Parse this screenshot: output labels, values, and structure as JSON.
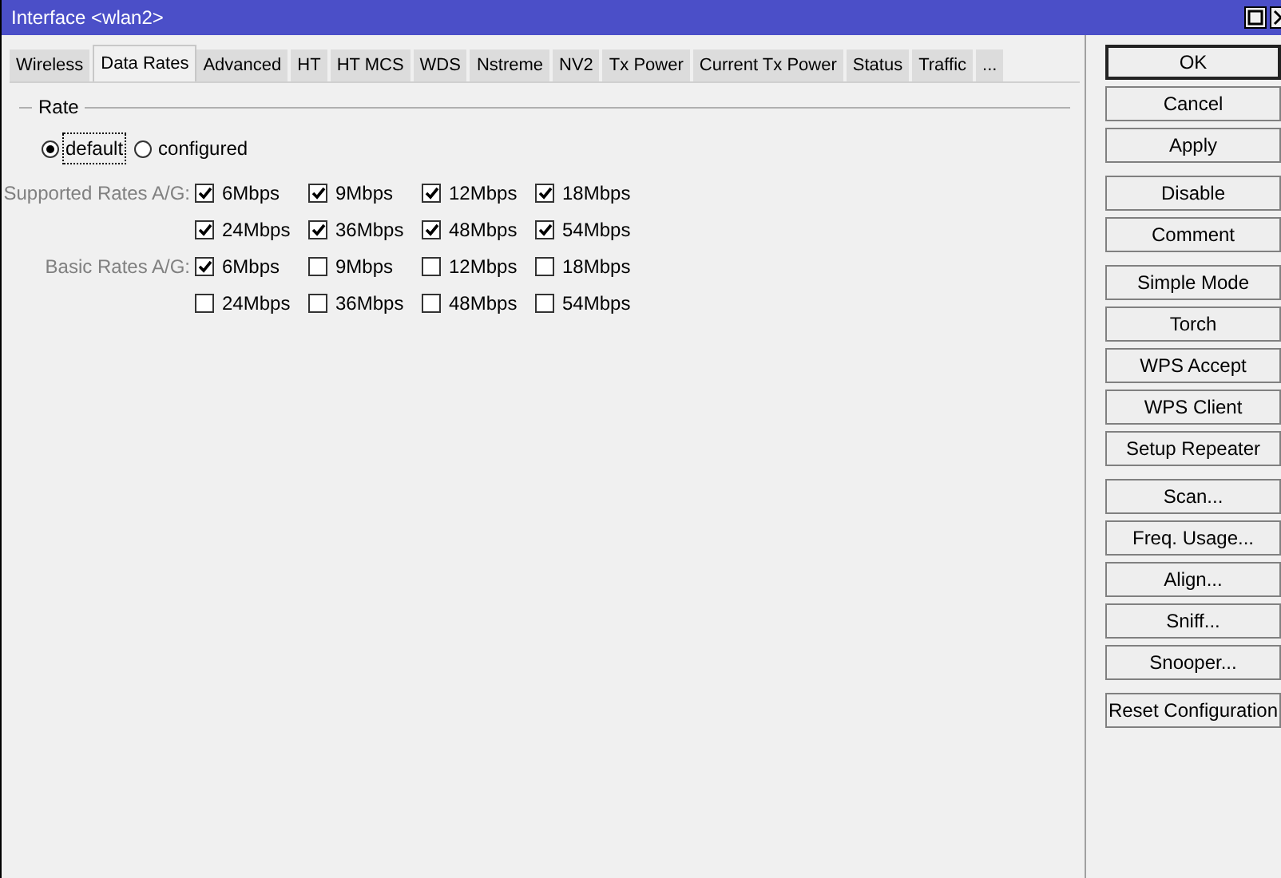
{
  "window": {
    "title": "Interface <wlan2>"
  },
  "tabs": [
    {
      "label": "Wireless",
      "selected": false
    },
    {
      "label": "Data Rates",
      "selected": true
    },
    {
      "label": "Advanced",
      "selected": false
    },
    {
      "label": "HT",
      "selected": false
    },
    {
      "label": "HT MCS",
      "selected": false
    },
    {
      "label": "WDS",
      "selected": false
    },
    {
      "label": "Nstreme",
      "selected": false
    },
    {
      "label": "NV2",
      "selected": false
    },
    {
      "label": "Tx Power",
      "selected": false
    },
    {
      "label": "Current Tx Power",
      "selected": false
    },
    {
      "label": "Status",
      "selected": false
    },
    {
      "label": "Traffic",
      "selected": false
    },
    {
      "label": "...",
      "selected": false
    }
  ],
  "rate": {
    "title": "Rate",
    "options": [
      {
        "label": "default",
        "selected": true
      },
      {
        "label": "configured",
        "selected": false
      }
    ],
    "groups": [
      {
        "label": "Supported Rates A/G:",
        "rates": [
          {
            "label": "6Mbps",
            "checked": true
          },
          {
            "label": "9Mbps",
            "checked": true
          },
          {
            "label": "12Mbps",
            "checked": true
          },
          {
            "label": "18Mbps",
            "checked": true
          },
          {
            "label": "24Mbps",
            "checked": true
          },
          {
            "label": "36Mbps",
            "checked": true
          },
          {
            "label": "48Mbps",
            "checked": true
          },
          {
            "label": "54Mbps",
            "checked": true
          }
        ]
      },
      {
        "label": "Basic Rates A/G:",
        "rates": [
          {
            "label": "6Mbps",
            "checked": true
          },
          {
            "label": "9Mbps",
            "checked": false
          },
          {
            "label": "12Mbps",
            "checked": false
          },
          {
            "label": "18Mbps",
            "checked": false
          },
          {
            "label": "24Mbps",
            "checked": false
          },
          {
            "label": "36Mbps",
            "checked": false
          },
          {
            "label": "48Mbps",
            "checked": false
          },
          {
            "label": "54Mbps",
            "checked": false
          }
        ]
      }
    ]
  },
  "button_groups": [
    [
      "OK",
      "Cancel",
      "Apply"
    ],
    [
      "Disable",
      "Comment"
    ],
    [
      "Simple Mode",
      "Torch",
      "WPS Accept",
      "WPS Client",
      "Setup Repeater"
    ],
    [
      "Scan...",
      "Freq. Usage...",
      "Align...",
      "Sniff...",
      "Snooper..."
    ],
    [
      "Reset Configuration"
    ]
  ]
}
